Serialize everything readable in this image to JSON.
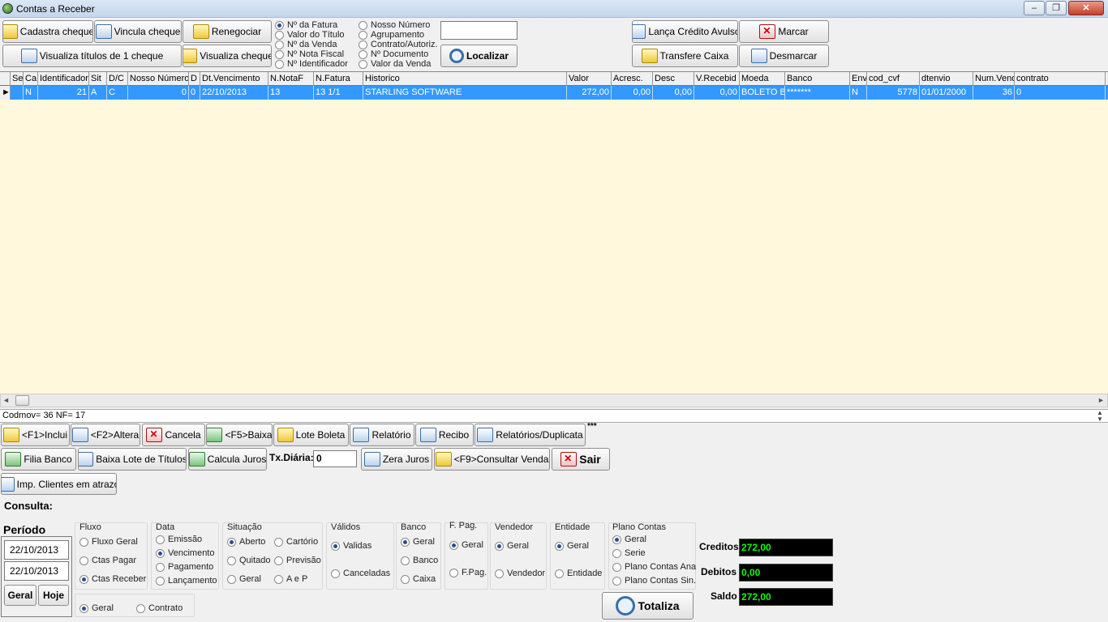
{
  "window": {
    "title": "Contas a Receber",
    "minimize": "‒",
    "maximize": "❐",
    "close": "✕"
  },
  "toolbar": {
    "cadastra_cheque": "Cadastra cheque",
    "vincula_cheque": "Vincula cheque",
    "renegociar": "Renegociar",
    "visualiza_titulos": "Visualiza títulos de 1 cheque",
    "visualiza_cheque": "Visualiza cheque",
    "localizar": "Localizar",
    "search_value": "",
    "lanca_credito": "Lança Crédito Avulso",
    "marcar": "Marcar",
    "transfere_caixa": "Transfere Caixa",
    "desmarcar": "Desmarcar"
  },
  "search_options": {
    "col1": [
      "Nº da Fatura",
      "Valor do Título",
      "Nº da Venda",
      "Nº Nota Fiscal",
      "Nº Identificador"
    ],
    "col2": [
      "Nosso Número",
      "Agrupamento",
      "Contrato/Autoriz.",
      "Nº Documento",
      "Valor da Venda"
    ],
    "selected": "Nº da Fatura"
  },
  "grid": {
    "columns": [
      "Se",
      "Ca",
      "Identificador",
      "Sit",
      "D/C",
      "Nosso Número",
      "D",
      "Dt.Vencimento",
      "N.NotaF",
      "N.Fatura",
      "Historico",
      "Valor",
      "Acresc.",
      "Desc",
      "V.Recebid",
      "Moeda",
      "Banco",
      "Env",
      "cod_cvf",
      "dtenvio",
      "Num.Vend",
      "contrato"
    ],
    "rows": [
      [
        "",
        "N",
        "21",
        "A",
        "C",
        "0",
        "0",
        "22/10/2013",
        "13",
        "13 1/1",
        "STARLING SOFTWARE",
        "272,00",
        "0,00",
        "0,00",
        "0,00",
        "BOLETO B",
        "*******",
        "N",
        "5778",
        "01/01/2000",
        "36",
        "0"
      ]
    ]
  },
  "status_line": "Codmov= 36 NF= 17",
  "actions": {
    "inclui": "<F1>Inclui",
    "altera": "<F2>Altera",
    "cancela": "Cancela",
    "baixa": "<F5>Baixa",
    "lote_boleta": "Lote Boleta",
    "relatorio": "Relatório",
    "recibo": "Recibo",
    "relatorios_duplicata": "Relatórios/Duplicata",
    "asterisks": "***",
    "filia_banco": "Filia Banco",
    "baixa_lote": "Baixa Lote de Títulos",
    "calcula_juros": "Calcula Juros",
    "tx_diaria_label": "Tx.Diária:",
    "tx_diaria_value": "0",
    "zera_juros": "Zera Juros",
    "consultar_venda": "<F9>Consultar Venda",
    "sair": "Sair",
    "imp_clientes": "Imp. Clientes em atrazo"
  },
  "consulta": {
    "label": "Consulta:",
    "periodo": "Período",
    "date_from": "22/10/2013",
    "date_to": "22/10/2013",
    "geral_btn": "Geral",
    "hoje_btn": "Hoje",
    "fluxo": {
      "title": "Fluxo",
      "options": [
        "Fluxo Geral",
        "Ctas Pagar",
        "Ctas Receber"
      ],
      "selected": 2
    },
    "data": {
      "title": "Data",
      "options": [
        "Emissão",
        "Vencimento",
        "Pagamento",
        "Lançamento"
      ],
      "selected": 1
    },
    "situacao": {
      "title": "Situação",
      "options": [
        "Aberto",
        "Cartório",
        "Quitado",
        "Previsão",
        "Geral",
        "A e P"
      ],
      "selected": 0
    },
    "validos": {
      "title": "Válidos",
      "options": [
        "Validas",
        "Canceladas"
      ],
      "selected": 0
    },
    "banco": {
      "title": "Banco",
      "options": [
        "Geral",
        "Banco",
        "Caixa"
      ],
      "selected": 0
    },
    "fpag": {
      "title": "F. Pag.",
      "options": [
        "Geral",
        "F.Pag."
      ],
      "selected": 0
    },
    "vendedor": {
      "title": "Vendedor",
      "options": [
        "Geral",
        "Vendedor"
      ],
      "selected": 0
    },
    "entidade": {
      "title": "Entidade",
      "options": [
        "Geral",
        "Entidade"
      ],
      "selected": 0
    },
    "plano": {
      "title": "Plano Contas",
      "options": [
        "Geral",
        "Serie",
        "Plano Contas Ana",
        "Plano Contas Sin."
      ],
      "selected": 0
    },
    "tipo": {
      "options": [
        "Geral",
        "Contrato"
      ],
      "selected": 0
    }
  },
  "totals": {
    "creditos_label": "Creditos",
    "creditos": "272,00",
    "debitos_label": "Debitos",
    "debitos": "0,00",
    "saldo_label": "Saldo",
    "saldo": "272,00",
    "totaliza": "Totaliza"
  }
}
